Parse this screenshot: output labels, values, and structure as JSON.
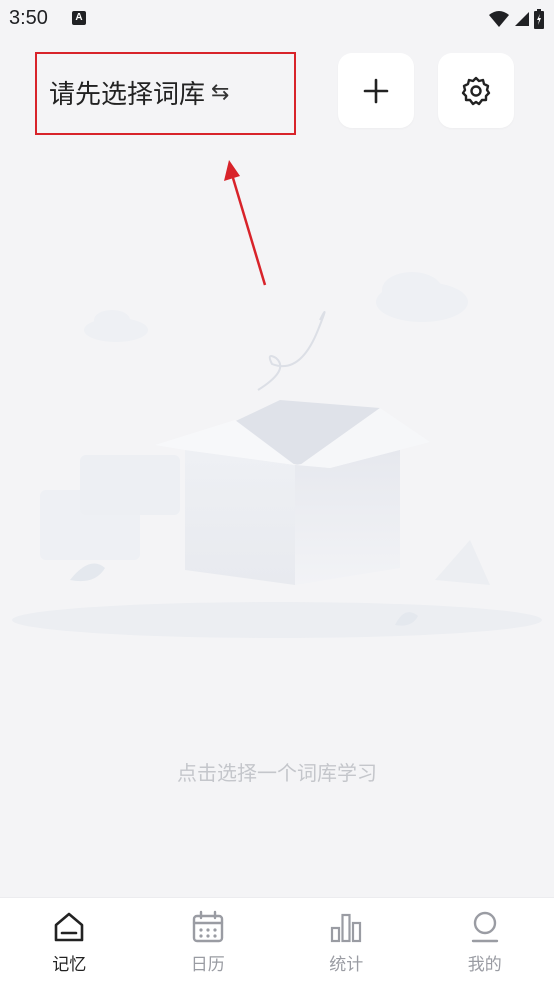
{
  "status": {
    "time": "3:50",
    "app_icon_letter": "A"
  },
  "header": {
    "title": "请先选择词库",
    "swap_icon": "swap-arrows-icon"
  },
  "actions": {
    "add_icon": "plus-icon",
    "settings_icon": "gear-icon"
  },
  "empty": {
    "hint": "点击选择一个词库学习",
    "illustration": "open-box"
  },
  "tabs": [
    {
      "label": "记忆",
      "icon": "home-icon",
      "active": true
    },
    {
      "label": "日历",
      "icon": "calendar-icon",
      "active": false
    },
    {
      "label": "统计",
      "icon": "bar-chart-icon",
      "active": false
    },
    {
      "label": "我的",
      "icon": "profile-icon",
      "active": false
    }
  ],
  "colors": {
    "highlight": "#d8232a",
    "background": "#f4f4f6",
    "active_tab": "#222222",
    "inactive_tab": "#9a9ca3"
  }
}
